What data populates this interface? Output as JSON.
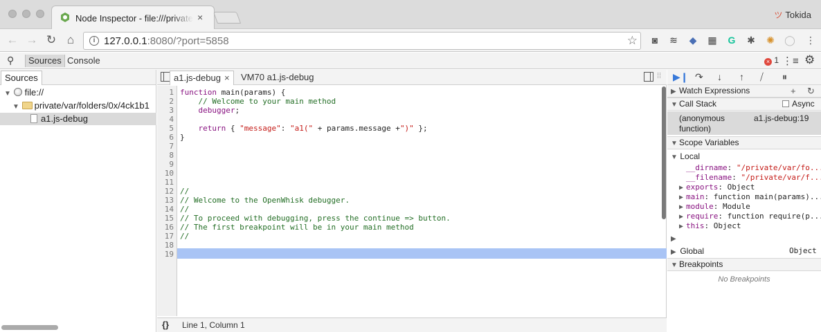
{
  "browser": {
    "tab_title": "Node Inspector - file:///private/var/folders",
    "tab_close": "×",
    "profile_name": "Tokida",
    "url_host": "127.0.0.1",
    "url_rest": ":8080/?port=5858",
    "info_icon": "i",
    "nav_icons": [
      "back-icon",
      "forward-icon",
      "reload-icon",
      "home-icon"
    ],
    "extension_icons": [
      "pocket-icon",
      "buffer-icon",
      "bird-icon",
      "film-icon",
      "grammarly-icon",
      "bug-icon",
      "spider-icon",
      "circle-icon",
      "menu-icon"
    ]
  },
  "devtools": {
    "tabs": [
      "Sources",
      "Console"
    ],
    "error_count": "1",
    "error_glyph": "×"
  },
  "navigator": {
    "tab_label": "Sources",
    "tree": [
      {
        "label": "file://",
        "depth": 0,
        "kind": "origin"
      },
      {
        "label": "private/var/folders/0x/4ck1b1",
        "depth": 1,
        "kind": "folder"
      },
      {
        "label": "a1.js-debug",
        "depth": 2,
        "kind": "file",
        "selected": true
      }
    ]
  },
  "editor": {
    "tabs": [
      {
        "label": "a1.js-debug",
        "active": true,
        "closable": true
      },
      {
        "label": "VM70 a1.js-debug",
        "active": false,
        "closable": false
      }
    ],
    "tab_close": "×",
    "line_numbers": [
      "1",
      "2",
      "3",
      "4",
      "5",
      "6",
      "7",
      "8",
      "9",
      "10",
      "11",
      "12",
      "13",
      "14",
      "15",
      "16",
      "17",
      "18",
      "19"
    ],
    "code_lines": [
      "function main(params) {",
      "    // Welcome to your main method",
      "    debugger;",
      "",
      "    return { \"message\": \"a1(\" + params.message +\")\" };",
      "}",
      "",
      "",
      "",
      "",
      "",
      "//",
      "// Welcome to the OpenWhisk debugger.",
      "//",
      "// To proceed with debugging, press the continue => button.",
      "// The first breakpoint will be in your main method",
      "//",
      "",
      ""
    ],
    "current_line": 19,
    "status_braces": "{}",
    "status_position": "Line 1, Column 1"
  },
  "sidebar": {
    "watch_title": "Watch Expressions",
    "callstack_title": "Call Stack",
    "async_label": "Async",
    "frame_name": "(anonymous function)",
    "frame_location": "a1.js-debug:19",
    "scope_title": "Scope Variables",
    "local_label": "Local",
    "variables": [
      {
        "name": "__dirname",
        "value": "\"/private/var/fo...",
        "expandable": false,
        "is_string": true
      },
      {
        "name": "__filename",
        "value": "\"/private/var/f...",
        "expandable": false,
        "is_string": true
      },
      {
        "name": "exports",
        "value": "Object",
        "expandable": true,
        "is_string": false
      },
      {
        "name": "main",
        "value": "function main(params)...",
        "expandable": true,
        "is_string": false
      },
      {
        "name": "module",
        "value": "Module",
        "expandable": true,
        "is_string": false
      },
      {
        "name": "require",
        "value": "function require(p...",
        "expandable": true,
        "is_string": false
      },
      {
        "name": "this",
        "value": "Object",
        "expandable": true,
        "is_string": false
      }
    ],
    "global_label": "Global",
    "global_value": "Object",
    "breakpoints_title": "Breakpoints",
    "no_breakpoints": "No Breakpoints"
  }
}
